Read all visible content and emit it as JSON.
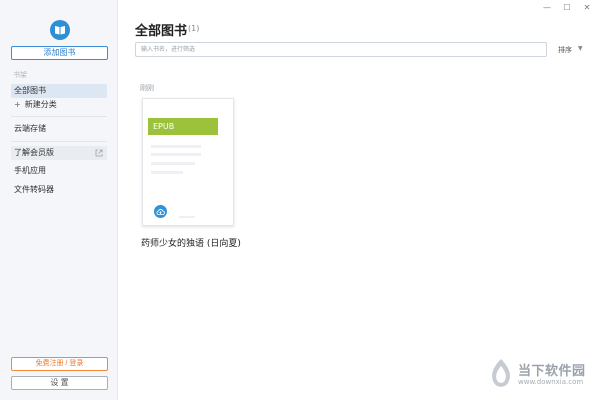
{
  "window": {
    "controls": [
      "—",
      "☐",
      "✕"
    ]
  },
  "sidebar": {
    "logo_icon": "book-icon",
    "add_book_label": "添加图书",
    "section_label": "书架",
    "items": [
      {
        "label": "全部图书",
        "active": true
      },
      {
        "label": "新建分类",
        "prefix": "+"
      },
      {
        "label": "云端存储"
      },
      {
        "label": "了解会员版",
        "icon": "external-link-icon"
      },
      {
        "label": "手机应用"
      },
      {
        "label": "文件转码器"
      }
    ],
    "register_label": "免费注册 / 登录",
    "settings_label": "设 置"
  },
  "main": {
    "title": "全部图书",
    "count": "(1)",
    "search_placeholder": "输入书名，进行筛选",
    "sort_label": "排序",
    "group_label": "刚刚",
    "books": [
      {
        "format": "EPUB",
        "title": "药师少女的独语 (日向夏)",
        "badge_icon": "cloud-upload-icon"
      }
    ]
  },
  "watermark": {
    "name": "当下软件园",
    "url": "www.downxia.com"
  },
  "colors": {
    "accent": "#2d8fd5",
    "epub_green": "#9cc23c",
    "register_orange": "#e9782a"
  }
}
